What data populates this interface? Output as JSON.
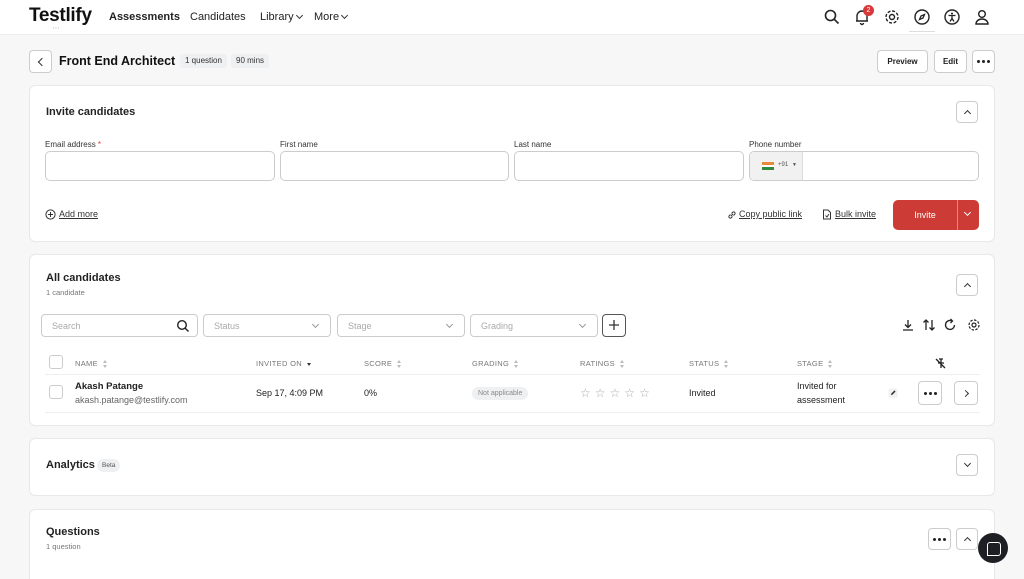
{
  "app": {
    "logo": "Testlify",
    "nav": [
      {
        "label": "Assessments"
      },
      {
        "label": "Candidates"
      },
      {
        "label": "Library"
      },
      {
        "label": "More"
      }
    ],
    "notification_count": "2"
  },
  "header": {
    "title": "Front End Architect",
    "questions_chip": "1 question",
    "duration_chip": "90 mins",
    "preview_label": "Preview",
    "edit_label": "Edit"
  },
  "invite": {
    "title": "Invite candidates",
    "email_label": "Email address",
    "email_required": "*",
    "first_name_label": "First name",
    "last_name_label": "Last name",
    "phone_label": "Phone number",
    "phone_code": "+91",
    "add_more": "Add more",
    "copy_link": "Copy public link",
    "bulk_invite": "Bulk invite",
    "invite_label": "Invite"
  },
  "candidates": {
    "title": "All candidates",
    "count": "1 candidate",
    "search_placeholder": "Search",
    "filters": [
      "Status",
      "Stage",
      "Grading"
    ],
    "columns": [
      "NAME",
      "INVITED ON",
      "SCORE",
      "GRADING",
      "RATINGS",
      "STATUS",
      "STAGE"
    ],
    "rows": [
      {
        "name": "Akash Patange",
        "email": "akash.patange@testlify.com",
        "invited_on": "Sep 17, 4:09 PM",
        "score": "0%",
        "grading": "Not applicable",
        "rating": 0,
        "status": "Invited",
        "stage_line1": "Invited for",
        "stage_line2": "assessment"
      }
    ]
  },
  "analytics": {
    "title": "Analytics",
    "badge": "Beta"
  },
  "questions": {
    "title": "Questions",
    "count": "1 question"
  }
}
